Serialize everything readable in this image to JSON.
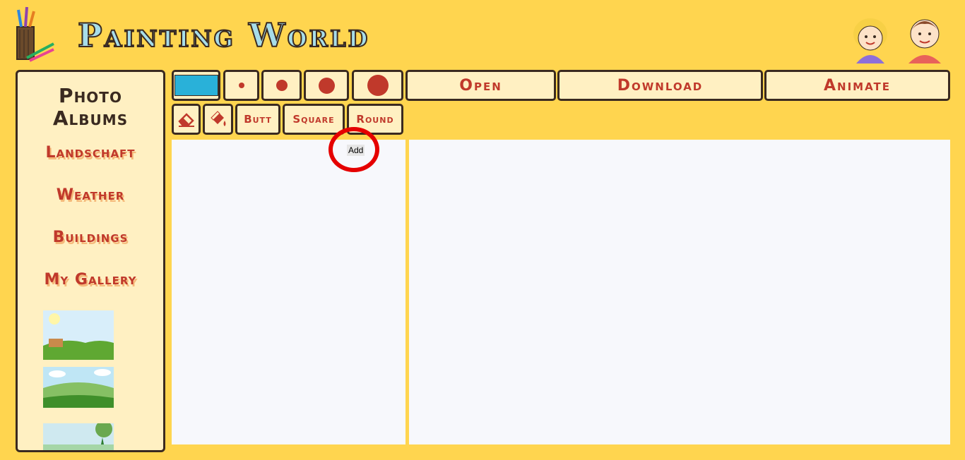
{
  "header": {
    "title": "Painting World",
    "logo_icon": "pencil-cup-icon",
    "avatars": [
      "girl-avatar-icon",
      "boy-avatar-icon"
    ]
  },
  "sidebar": {
    "title_line1": "Photo",
    "title_line2": "Albums",
    "albums": [
      "Landschaft",
      "Weather",
      "Buildings",
      "My Gallery"
    ],
    "thumbnails": [
      "landscape-sign-thumbnail",
      "green-hills-thumbnail",
      "tree-field-thumbnail"
    ]
  },
  "toolbar": {
    "current_color": "#29b1d9",
    "brush_sizes": [
      "tiny",
      "small",
      "medium",
      "large"
    ],
    "open_label": "Open",
    "download_label": "Download",
    "animate_label": "Animate",
    "eraser_icon": "eraser-icon",
    "fill_icon": "paint-bucket-icon",
    "linecap_butt": "Butt",
    "linecap_square": "Square",
    "linecap_round": "Round"
  },
  "canvas": {
    "add_label": "Add"
  },
  "colors": {
    "background": "#ffd54f",
    "panel": "#fff0c2",
    "accent": "#c0392b",
    "border": "#3a2a20",
    "highlight": "#e50000"
  }
}
